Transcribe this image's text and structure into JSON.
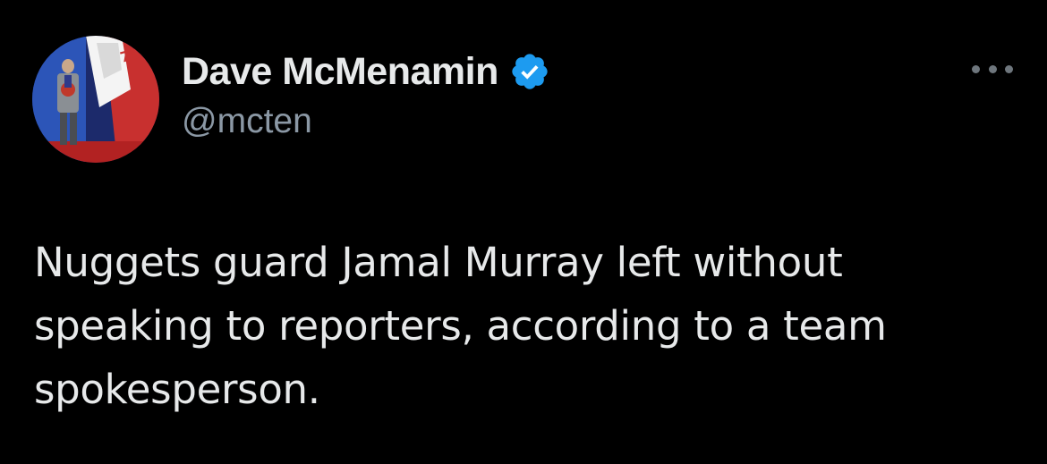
{
  "tweet": {
    "author": {
      "display_name": "Dave McMenamin",
      "handle": "@mcten",
      "verified": true
    },
    "text": "Nuggets guard Jamal Murray left without speaking to reporters, according to a team spokesperson.",
    "more_icon": "more-horizontal-icon",
    "verified_icon": "verified-badge-icon",
    "colors": {
      "background": "#000000",
      "primary_text": "#e7e9ea",
      "secondary_text": "#8b98a5",
      "verified_blue": "#1d9bf0"
    }
  }
}
